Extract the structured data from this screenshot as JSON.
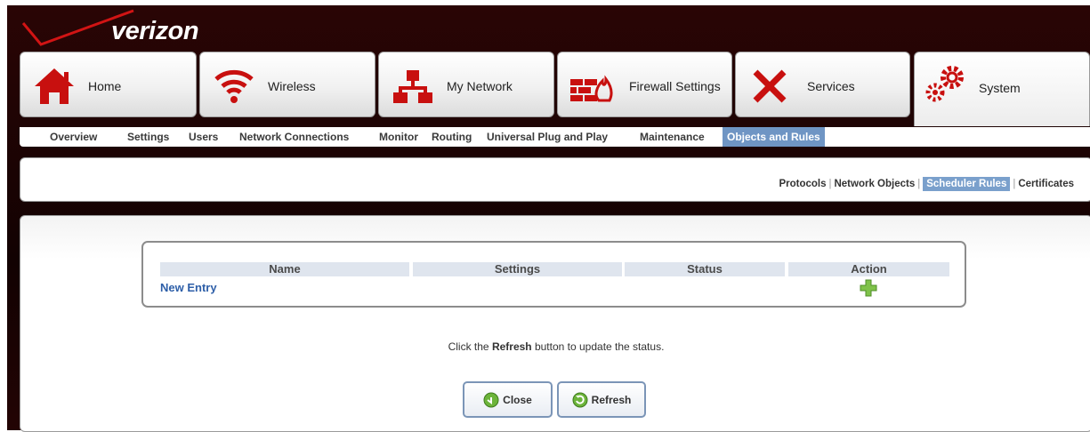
{
  "brand": {
    "logo_text": "verizon"
  },
  "tabs": [
    {
      "label": "Home",
      "icon": "home-icon"
    },
    {
      "label": "Wireless",
      "icon": "wireless-icon"
    },
    {
      "label": "My Network",
      "icon": "network-icon"
    },
    {
      "label": "Firewall Settings",
      "icon": "firewall-icon"
    },
    {
      "label": "Services",
      "icon": "tools-icon"
    },
    {
      "label": "System",
      "icon": "gears-icon",
      "active": true
    }
  ],
  "subnav": [
    {
      "label": "Overview"
    },
    {
      "label": "Settings"
    },
    {
      "label": "Users"
    },
    {
      "label": "Network Connections"
    },
    {
      "label": "Monitor"
    },
    {
      "label": "Routing"
    },
    {
      "label": "Universal Plug and Play"
    },
    {
      "label": "Maintenance"
    },
    {
      "label": "Objects and Rules",
      "active": true
    }
  ],
  "section_links": [
    {
      "label": "Protocols"
    },
    {
      "label": "Network Objects"
    },
    {
      "label": "Scheduler Rules",
      "active": true
    },
    {
      "label": "Certificates"
    }
  ],
  "table": {
    "columns": [
      "Name",
      "Settings",
      "Status",
      "Action"
    ],
    "new_entry": "New Entry"
  },
  "message": {
    "prefix": "Click the ",
    "bold": "Refresh",
    "suffix": " button to update the status."
  },
  "buttons": {
    "close": "Close",
    "refresh": "Refresh"
  },
  "colors": {
    "background": "#160303",
    "accent": "#6f95c4",
    "brand_red": "#cc1010",
    "link": "#2e5fa8"
  }
}
